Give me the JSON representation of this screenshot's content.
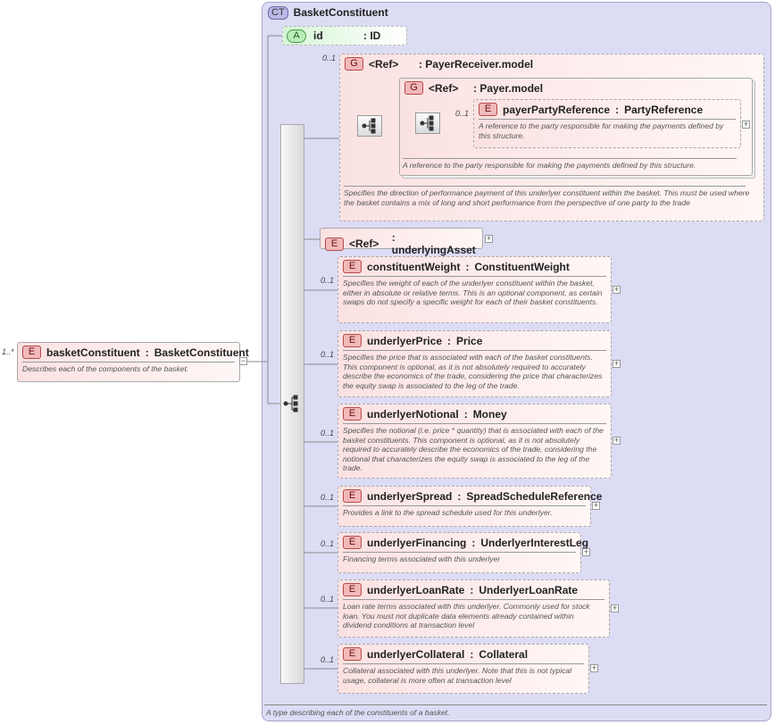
{
  "complex_type": {
    "badge": "CT",
    "name": "BasketConstituent",
    "description": "A type describing each of the constituents of a basket."
  },
  "root_element": {
    "occurrence": "1..*",
    "badge": "E",
    "name": "basketConstituent",
    "type": "BasketConstituent",
    "description": "Describes each of the components of the basket."
  },
  "attribute": {
    "badge": "A",
    "name": "id",
    "type": ": ID"
  },
  "group_payer_receiver": {
    "occurrence": "0..1",
    "badge": "G",
    "ref": "<Ref>",
    "name": ": PayerReceiver.model",
    "description": "Specifies the direction of performance payment of this underlyer constituent within the basket. This must be used where the basket contains a mix of long and short performance from the perspective of one party to the trade"
  },
  "group_payer": {
    "badge": "G",
    "ref": "<Ref>",
    "name": ": Payer.model",
    "description": "A reference to the party responsible for making the payments defined by this structure."
  },
  "payer_party_reference": {
    "occurrence": "0..1",
    "badge": "E",
    "name": "payerPartyReference",
    "type": "PartyReference",
    "description": "A reference to the party responsible for making the payments defined by this structure."
  },
  "underlying_asset": {
    "badge": "E",
    "ref": "<Ref>",
    "name": ": underlyingAsset"
  },
  "elements": [
    {
      "occurrence": "0..1",
      "badge": "E",
      "name": "constituentWeight",
      "type": "ConstituentWeight",
      "description": "Specifies the weight of each of the underlyer constituent within the basket, either in absolute or relative terms. This is an optional component, as certain swaps do not specify a specific weight for each of their basket constituents."
    },
    {
      "occurrence": "0..1",
      "badge": "E",
      "name": "underlyerPrice",
      "type": "Price",
      "description": "Specifies the price that is associated with each of the basket constituents. This component is optional, as it is not absolutely required to accurately describe the economics of the trade, considering the price that characterizes the equity swap is associated to the leg of the trade."
    },
    {
      "occurrence": "0..1",
      "badge": "E",
      "name": "underlyerNotional",
      "type": "Money",
      "description": "Specifies the notional (i.e. price * quantity) that is associated with each of the basket constituents. This component is optional, as it is not absolutely required to accurately describe the economics of the trade, considering the notional that characterizes the equity swap is associated to the leg of the trade."
    },
    {
      "occurrence": "0..1",
      "badge": "E",
      "name": "underlyerSpread",
      "type": "SpreadScheduleReference",
      "description": "Provides a link to the spread schedule used for this underlyer."
    },
    {
      "occurrence": "0..1",
      "badge": "E",
      "name": "underlyerFinancing",
      "type": "UnderlyerInterestLeg",
      "description": "Financing terms associated with this underlyer"
    },
    {
      "occurrence": "0..1",
      "badge": "E",
      "name": "underlyerLoanRate",
      "type": "UnderlyerLoanRate",
      "description": "Loan rate terms associated with this underlyer. Commonly used for stock loan. You must not duplicate data elements already contained within dividend conditions at transaction level"
    },
    {
      "occurrence": "0..1",
      "badge": "E",
      "name": "underlyerCollateral",
      "type": "Collateral",
      "description": "Collateral associated with this underlyer. Note that this is not typical usage, collateral is more often at transaction level"
    }
  ],
  "colon": ":",
  "plus_symbol": "+",
  "minus_symbol": "−",
  "icons": {
    "sequence": "sequence-icon",
    "expand": "expand-icon",
    "collapse": "collapse-icon"
  }
}
